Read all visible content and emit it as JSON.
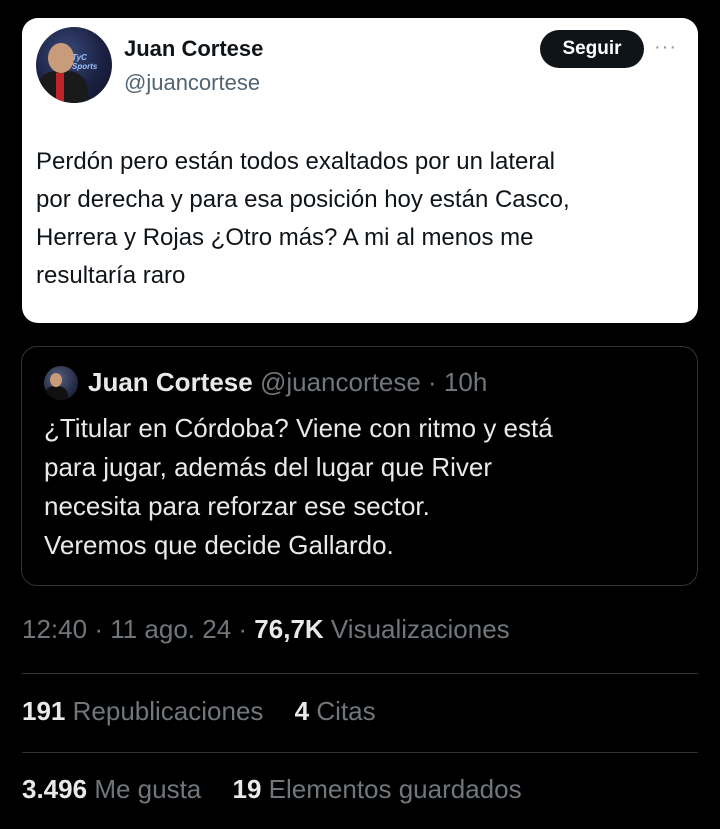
{
  "tweet": {
    "author_name": "Juan Cortese",
    "author_handle": "@juancortese",
    "avatar_logo_text": "TyC Sports",
    "follow_label": "Seguir",
    "more_label": "···",
    "text_lines": [
      "Perdón pero están todos exaltados por un lateral",
      "por derecha y para esa posición hoy están Casco,",
      "Herrera y Rojas ¿Otro más? A mi al menos me",
      "resultaría raro"
    ]
  },
  "quoted": {
    "author_name": "Juan Cortese",
    "author_handle": "@juancortese",
    "time_ago": "10h",
    "text_lines": [
      "¿Titular en Córdoba? Viene con ritmo y está",
      "para jugar, además del lugar que River",
      "necesita para reforzar ese sector.",
      "Veremos que decide Gallardo."
    ]
  },
  "meta": {
    "time": "12:40",
    "date": "11 ago. 24",
    "views_count": "76,7K",
    "views_label": "Visualizaciones"
  },
  "stats": {
    "reposts_count": "191",
    "reposts_label": "Republicaciones",
    "quotes_count": "4",
    "quotes_label": "Citas",
    "likes_count": "3.496",
    "likes_label": "Me gusta",
    "bookmarks_count": "19",
    "bookmarks_label": "Elementos guardados"
  }
}
